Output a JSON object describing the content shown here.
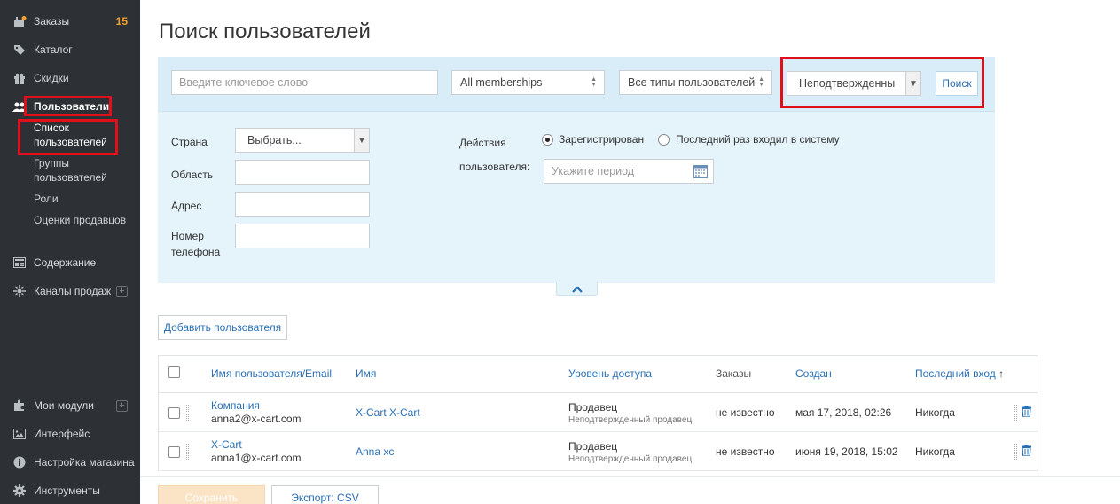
{
  "sidebar": {
    "orders": {
      "label": "Заказы",
      "badge": "15"
    },
    "catalog": {
      "label": "Каталог"
    },
    "discounts": {
      "label": "Скидки"
    },
    "users": {
      "label": "Пользователи"
    },
    "users_sub": [
      "Список пользователей",
      "Группы пользователей",
      "Роли",
      "Оценки продавцов"
    ],
    "content": {
      "label": "Содержание"
    },
    "channels": {
      "label": "Каналы продаж"
    },
    "modules": {
      "label": "Мои модули"
    },
    "interface": {
      "label": "Интерфейс"
    },
    "settings": {
      "label": "Настройка магазина"
    },
    "tools": {
      "label": "Инструменты"
    }
  },
  "page": {
    "title": "Поиск пользователей"
  },
  "search": {
    "keyword_placeholder": "Введите ключевое слово",
    "membership": "All memberships",
    "user_type": "Все типы пользователей",
    "status": "Неподтвержденны",
    "search_button": "Поиск",
    "country_label": "Страна",
    "country_value": "Выбрать...",
    "region_label": "Область",
    "address_label": "Адрес",
    "phone_label": "Номер телефона",
    "actions_label": "Действия пользователя:",
    "radio_registered": "Зарегистрирован",
    "radio_last_login": "Последний раз входил в систему",
    "period_placeholder": "Укажите период"
  },
  "actions": {
    "add_user": "Добавить пользователя",
    "save": "Сохранить",
    "export": "Экспорт: CSV"
  },
  "table": {
    "headers": {
      "login": "Имя пользователя/Email",
      "name": "Имя",
      "access": "Уровень доступа",
      "orders": "Заказы",
      "created": "Создан",
      "last_login": "Последний вход"
    },
    "rows": [
      {
        "login": "Компания",
        "email": "anna2@x-cart.com",
        "name": "X-Cart X-Cart",
        "access": "Продавец",
        "access_sub": "Неподтвержденный продавец",
        "orders": "не известно",
        "created": "мая 17, 2018, 02:26",
        "last_login": "Никогда"
      },
      {
        "login": "X-Cart",
        "email": "anna1@x-cart.com",
        "name": "Anna xc",
        "access": "Продавец",
        "access_sub": "Неподтвержденный продавец",
        "orders": "не известно",
        "created": "июня 19, 2018, 15:02",
        "last_login": "Никогда"
      }
    ]
  },
  "colors": {
    "sidebar_bg": "#2d3135",
    "accent": "#2a6fb2",
    "highlight": "#e0101a",
    "badge": "#f0a22e"
  }
}
